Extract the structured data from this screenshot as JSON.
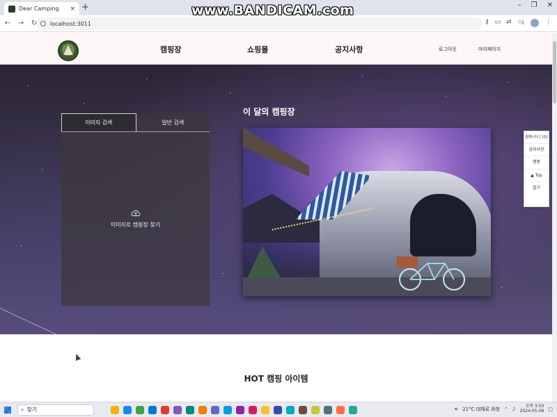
{
  "browser": {
    "tab_title": "Dear Camping",
    "tab_close": "×",
    "new_tab": "+",
    "url": "localhost:3011",
    "window_buttons": [
      "–",
      "❐",
      "✕"
    ],
    "nav": [
      "←",
      "→",
      "↻"
    ]
  },
  "watermark": "www.BANDICAM.com",
  "site": {
    "nav": {
      "campsite": "캠핑장",
      "shopping": "쇼핑몰",
      "notice": "공지사항",
      "login": "로그아웃",
      "mypage": "마이페이지"
    },
    "search_panel": {
      "tab_image": "이미지 검색",
      "tab_general": "일반 검색",
      "upload_text": "이미지로 캠핑장 찾기"
    },
    "month_title": "이 달의 캠핑장",
    "quick_menu": [
      "장바구니 (0)",
      "공지사항",
      "챗봇",
      "▲ Top",
      "접기"
    ],
    "hot_title": "HOT 캠핑 아이템"
  },
  "taskbar": {
    "search_placeholder": "찾기",
    "weather": "21°C 대체로 화창",
    "time": "오후 3:50",
    "date": "2024-05-08",
    "app_colors": [
      "#f4b400",
      "#1e88e5",
      "#43a047",
      "#0078d4",
      "#e53935",
      "#7e57c2",
      "#00897b",
      "#f57c00",
      "#5c6bc0",
      "#039be5",
      "#8e24aa",
      "#d81b60",
      "#fbc02d",
      "#3949ab",
      "#00acc1",
      "#6d4c41",
      "#c0ca33",
      "#546e7a",
      "#ff7043",
      "#26a69a"
    ]
  },
  "colors": {
    "accent": "#2c5aa0",
    "hero_dark": "#2a2533",
    "header_bg": "#fff7f7"
  }
}
